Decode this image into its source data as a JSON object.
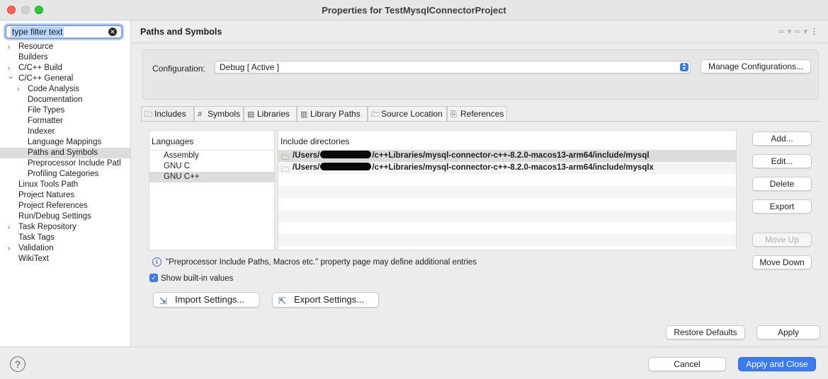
{
  "window": {
    "title": "Properties for TestMysqlConnectorProject"
  },
  "filter": {
    "value": "type filter text"
  },
  "tree": [
    {
      "label": "Resource",
      "level": 0,
      "expander": "closed"
    },
    {
      "label": "Builders",
      "level": 0,
      "expander": "none"
    },
    {
      "label": "C/C++ Build",
      "level": 0,
      "expander": "closed"
    },
    {
      "label": "C/C++ General",
      "level": 0,
      "expander": "open"
    },
    {
      "label": "Code Analysis",
      "level": 1,
      "expander": "closed"
    },
    {
      "label": "Documentation",
      "level": 1,
      "expander": "none"
    },
    {
      "label": "File Types",
      "level": 1,
      "expander": "none"
    },
    {
      "label": "Formatter",
      "level": 1,
      "expander": "none"
    },
    {
      "label": "Indexer",
      "level": 1,
      "expander": "none"
    },
    {
      "label": "Language Mappings",
      "level": 1,
      "expander": "none"
    },
    {
      "label": "Paths and Symbols",
      "level": 1,
      "expander": "none",
      "selected": true
    },
    {
      "label": "Preprocessor Include Patl",
      "level": 1,
      "expander": "none"
    },
    {
      "label": "Profiling Categories",
      "level": 1,
      "expander": "none"
    },
    {
      "label": "Linux Tools Path",
      "level": 0,
      "expander": "none"
    },
    {
      "label": "Project Natures",
      "level": 0,
      "expander": "none"
    },
    {
      "label": "Project References",
      "level": 0,
      "expander": "none"
    },
    {
      "label": "Run/Debug Settings",
      "level": 0,
      "expander": "none"
    },
    {
      "label": "Task Repository",
      "level": 0,
      "expander": "closed"
    },
    {
      "label": "Task Tags",
      "level": 0,
      "expander": "none"
    },
    {
      "label": "Validation",
      "level": 0,
      "expander": "closed"
    },
    {
      "label": "WikiText",
      "level": 0,
      "expander": "none"
    }
  ],
  "page": {
    "title": "Paths and Symbols"
  },
  "config": {
    "label": "Configuration:",
    "value": "Debug  [ Active ]",
    "manage_label": "Manage Configurations..."
  },
  "tabs": [
    {
      "label": "Includes",
      "icon": "includes-icon",
      "active": true
    },
    {
      "label": "Symbols",
      "icon": "hash-icon"
    },
    {
      "label": "Libraries",
      "icon": "libraries-icon"
    },
    {
      "label": "Library Paths",
      "icon": "library-paths-icon"
    },
    {
      "label": "Source Location",
      "icon": "folder-icon"
    },
    {
      "label": "References",
      "icon": "references-icon"
    }
  ],
  "languages": {
    "header": "Languages",
    "items": [
      "Assembly",
      "GNU C",
      "GNU C++"
    ],
    "selected_index": 2
  },
  "includes": {
    "header": "Include directories",
    "rows": [
      {
        "prefix": "/Users/",
        "suffix": "/c++Libraries/mysql-connector-c++-8.2.0-macos13-arm64/include/mysql"
      },
      {
        "prefix": "/Users/",
        "suffix": "/c++Libraries/mysql-connector-c++-8.2.0-macos13-arm64/include/mysqlx"
      }
    ]
  },
  "side_buttons": {
    "add": "Add...",
    "edit": "Edit...",
    "delete": "Delete",
    "export": "Export",
    "move_up": "Move Up",
    "move_down": "Move Down"
  },
  "info_text": "\"Preprocessor Include Paths, Macros etc.\" property page may define additional entries",
  "show_builtin": {
    "label": "Show built-in values",
    "checked": true
  },
  "import_settings": "Import Settings...",
  "export_settings": "Export Settings...",
  "restore_defaults": "Restore Defaults",
  "apply": "Apply",
  "cancel": "Cancel",
  "apply_close": "Apply and Close"
}
